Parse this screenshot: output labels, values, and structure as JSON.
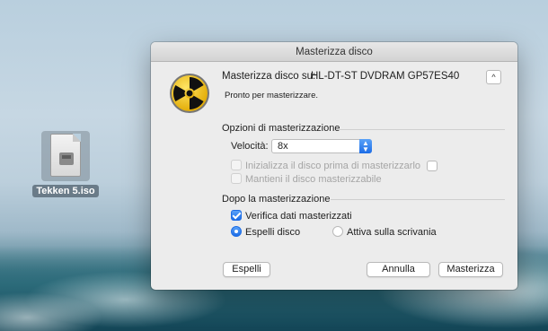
{
  "desktop": {
    "file_label": "Tekken 5.iso",
    "file_icon": "disk-image-icon"
  },
  "dialog": {
    "title": "Masterizza disco",
    "burn_icon": "radiation-burn-icon",
    "target_label": "Masterizza disco su:",
    "drive_name": "HL-DT-ST DVDRAM GP57ES40",
    "collapse_symbol": "^",
    "status": "Pronto per masterizzare."
  },
  "options": {
    "section_title": "Opzioni di masterizzazione",
    "speed_label": "Velocità:",
    "speed_value": "8x",
    "initialize_label": "Inizializza il disco prima di masterizzarlo",
    "keep_appendable_label": "Mantieni il disco masterizzabile"
  },
  "after_burn": {
    "section_title": "Dopo la masterizzazione",
    "verify_label": "Verifica dati masterizzati",
    "verify_checked": true,
    "eject_label": "Espelli disco",
    "eject_selected": true,
    "mount_label": "Attiva sulla scrivania",
    "mount_selected": false
  },
  "buttons": {
    "eject": "Espelli",
    "cancel": "Annulla",
    "burn": "Masterizza"
  },
  "colors": {
    "accent": "#1c6ce6",
    "dialog_bg": "#ececec",
    "burn_icon_yellow": "#f2c400"
  }
}
